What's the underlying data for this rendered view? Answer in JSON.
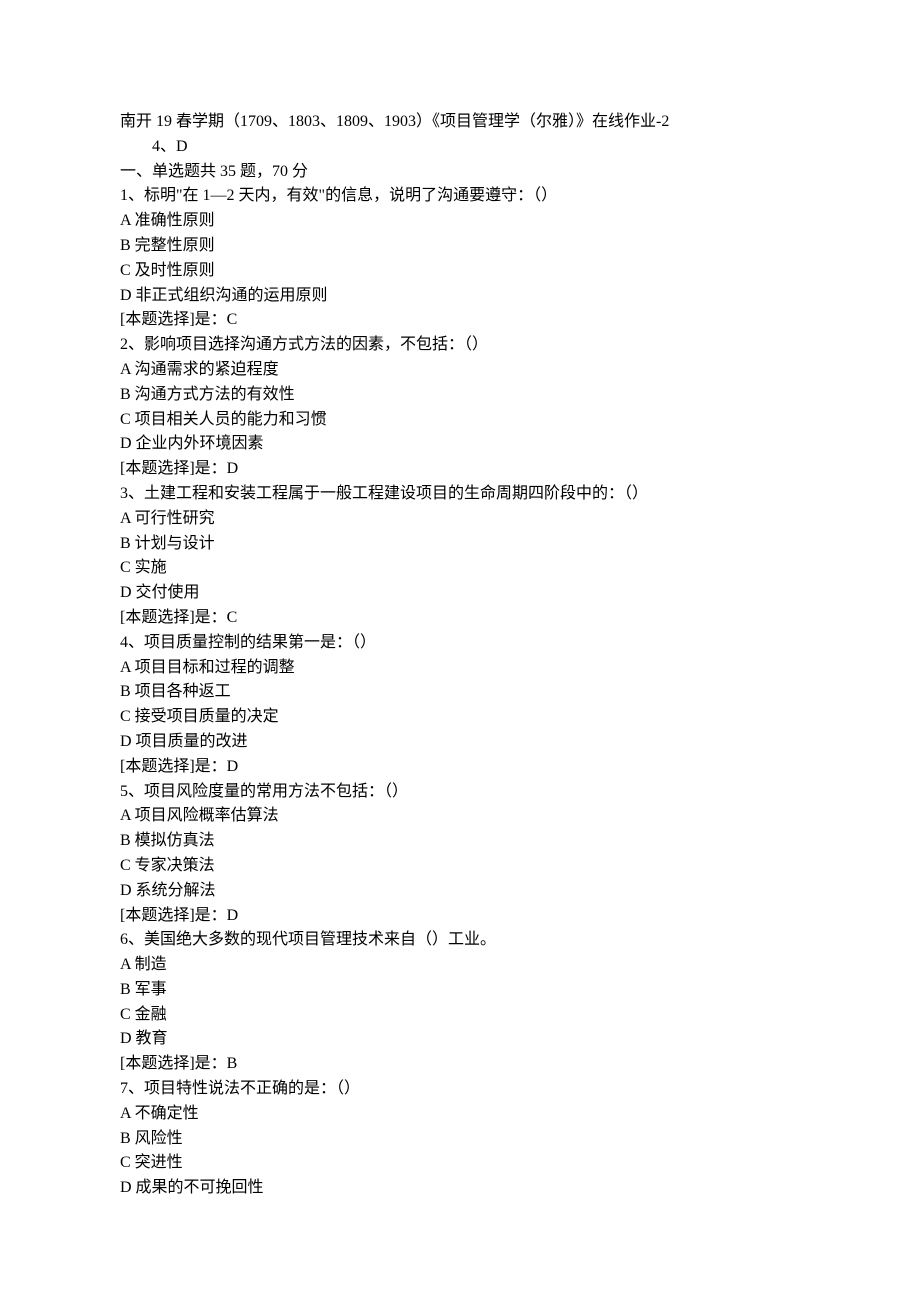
{
  "header": {
    "title": "南开 19 春学期（1709、1803、1809、1903）《项目管理学（尔雅）》在线作业-2",
    "subline": "4、D"
  },
  "section": {
    "heading": "一、单选题共 35 题，70 分"
  },
  "questions": [
    {
      "stem": "1、标明\"在 1—2 天内，有效\"的信息，说明了沟通要遵守：（）",
      "options": [
        "A 准确性原则",
        "B 完整性原则",
        "C 及时性原则",
        "D 非正式组织沟通的运用原则"
      ],
      "answer": "[本题选择]是：C"
    },
    {
      "stem": "2、影响项目选择沟通方式方法的因素，不包括：（）",
      "options": [
        "A 沟通需求的紧迫程度",
        "B 沟通方式方法的有效性",
        "C 项目相关人员的能力和习惯",
        "D 企业内外环境因素"
      ],
      "answer": "[本题选择]是：D"
    },
    {
      "stem": "3、土建工程和安装工程属于一般工程建设项目的生命周期四阶段中的：（）",
      "options": [
        "A 可行性研究",
        "B 计划与设计",
        "C 实施",
        "D 交付使用"
      ],
      "answer": "[本题选择]是：C"
    },
    {
      "stem": "4、项目质量控制的结果第一是：（）",
      "options": [
        "A 项目目标和过程的调整",
        "B 项目各种返工",
        "C 接受项目质量的决定",
        "D 项目质量的改进"
      ],
      "answer": "[本题选择]是：D"
    },
    {
      "stem": "5、项目风险度量的常用方法不包括：（）",
      "options": [
        "A 项目风险概率估算法",
        "B 模拟仿真法",
        "C 专家决策法",
        "D 系统分解法"
      ],
      "answer": "[本题选择]是：D"
    },
    {
      "stem": "6、美国绝大多数的现代项目管理技术来自（）工业。",
      "options": [
        "A 制造",
        "B 军事",
        "C 金融",
        "D 教育"
      ],
      "answer": "[本题选择]是：B"
    },
    {
      "stem": "7、项目特性说法不正确的是：（）",
      "options": [
        "A 不确定性",
        "B 风险性",
        "C 突进性",
        "D 成果的不可挽回性"
      ],
      "answer": ""
    }
  ]
}
